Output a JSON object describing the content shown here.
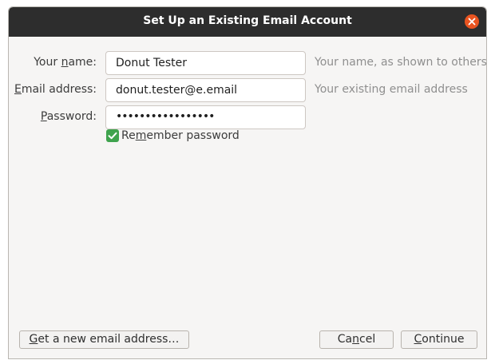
{
  "window": {
    "title": "Set Up an Existing Email Account"
  },
  "form": {
    "name": {
      "label_pre": "Your ",
      "label_u": "n",
      "label_post": "ame:",
      "value": "Donut Tester",
      "hint": "Your name, as shown to others"
    },
    "email": {
      "label_pre": "",
      "label_u": "E",
      "label_post": "mail address:",
      "value": "donut.tester@e.email",
      "hint": "Your existing email address"
    },
    "password": {
      "label_pre": "",
      "label_u": "P",
      "label_post": "assword:",
      "value": "•••••••••••••••••"
    },
    "remember": {
      "checked": true,
      "label_pre": "Re",
      "label_u": "m",
      "label_post": "ember password"
    }
  },
  "buttons": {
    "get_new": {
      "pre": "",
      "u": "G",
      "post": "et a new email address…"
    },
    "cancel": {
      "pre": "Ca",
      "u": "n",
      "post": "cel"
    },
    "continue": {
      "pre": "",
      "u": "C",
      "post": "ontinue"
    }
  },
  "colors": {
    "titlebar": "#2d2d2d",
    "close": "#e95420",
    "checkbox": "#3fa34d"
  },
  "icons": {
    "close": "close-icon",
    "check": "checkmark-icon"
  }
}
